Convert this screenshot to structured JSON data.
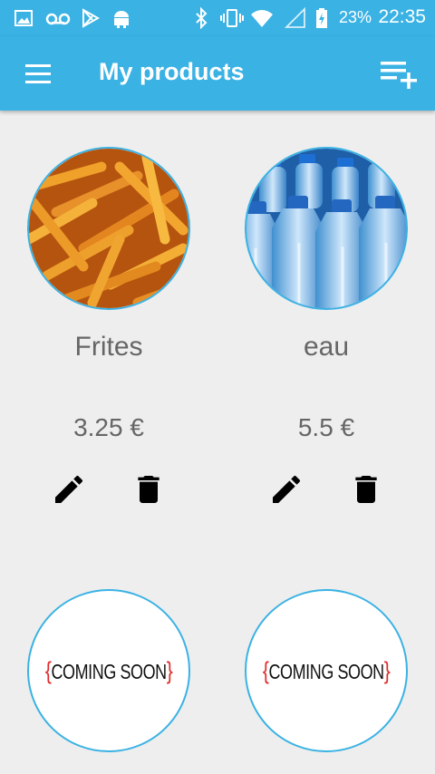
{
  "status_bar": {
    "battery_percent": "23%",
    "time": "22:35",
    "icons": [
      "image-icon",
      "voicemail-icon",
      "play-store-icon",
      "android-icon",
      "bluetooth-icon",
      "vibrate-icon",
      "wifi-icon",
      "signal-icon",
      "battery-charging-icon"
    ]
  },
  "app_bar": {
    "title": "My products",
    "menu_icon": "menu-icon",
    "add_icon": "playlist-add-icon"
  },
  "products": [
    {
      "name": "Frites",
      "price": "3.25 €",
      "image": "fries-photo"
    },
    {
      "name": "eau",
      "price": "5.5 €",
      "image": "water-bottles-photo"
    }
  ],
  "coming_soon": [
    {
      "open": "{",
      "text": "COMING SOON",
      "close": "}"
    },
    {
      "open": "{",
      "text": "COMING SOON",
      "close": "}"
    }
  ],
  "colors": {
    "primary": "#3ab2e4",
    "background": "#eeeeee",
    "text": "#666666",
    "accent_red": "#e02b2b"
  }
}
